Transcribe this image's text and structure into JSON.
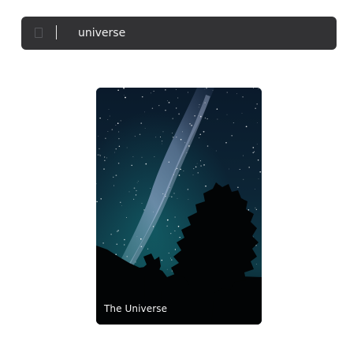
{
  "search": {
    "value": "universe",
    "icon": "search-icon"
  },
  "results": [
    {
      "title": "The Universe",
      "image": "milky-way-night-sky-with-tree-silhouette"
    }
  ]
}
